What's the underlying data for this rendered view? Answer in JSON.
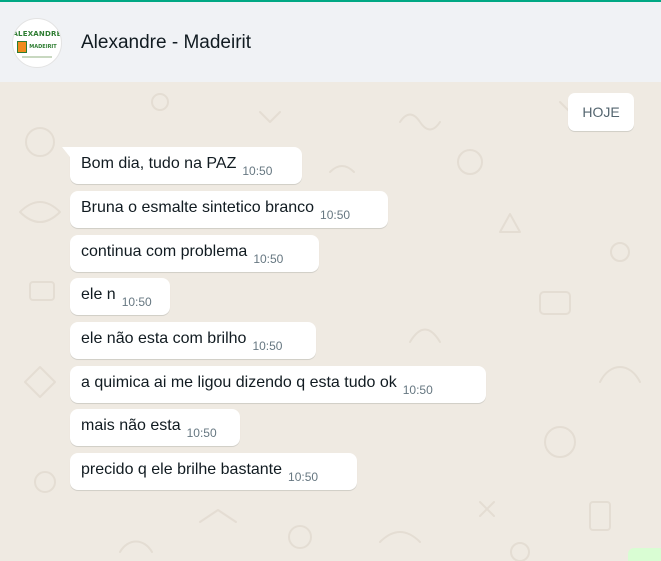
{
  "header": {
    "contact_name": "Alexandre - Madeirit",
    "avatar": {
      "label_top": "ALEXANDRE",
      "label_brand": "MADEIRIT"
    }
  },
  "chat": {
    "date_divider": "HOJE",
    "messages": [
      {
        "text": "Bom dia, tudo na PAZ",
        "time": "10:50"
      },
      {
        "text": "Bruna o esmalte sintetico branco",
        "time": "10:50"
      },
      {
        "text": "continua com problema",
        "time": "10:50"
      },
      {
        "text": "ele n",
        "time": "10:50"
      },
      {
        "text": "ele não esta com brilho",
        "time": "10:50"
      },
      {
        "text": "a quimica ai me ligou dizendo q esta tudo ok",
        "time": "10:50"
      },
      {
        "text": "mais não esta",
        "time": "10:50"
      },
      {
        "text": "precido q ele brilhe bastante",
        "time": "10:50"
      }
    ]
  },
  "colors": {
    "accent": "#00a884",
    "header_bg": "#f0f2f5",
    "chat_bg": "#efeae2",
    "bubble_in": "#ffffff",
    "text": "#111b21",
    "meta": "#667781"
  }
}
